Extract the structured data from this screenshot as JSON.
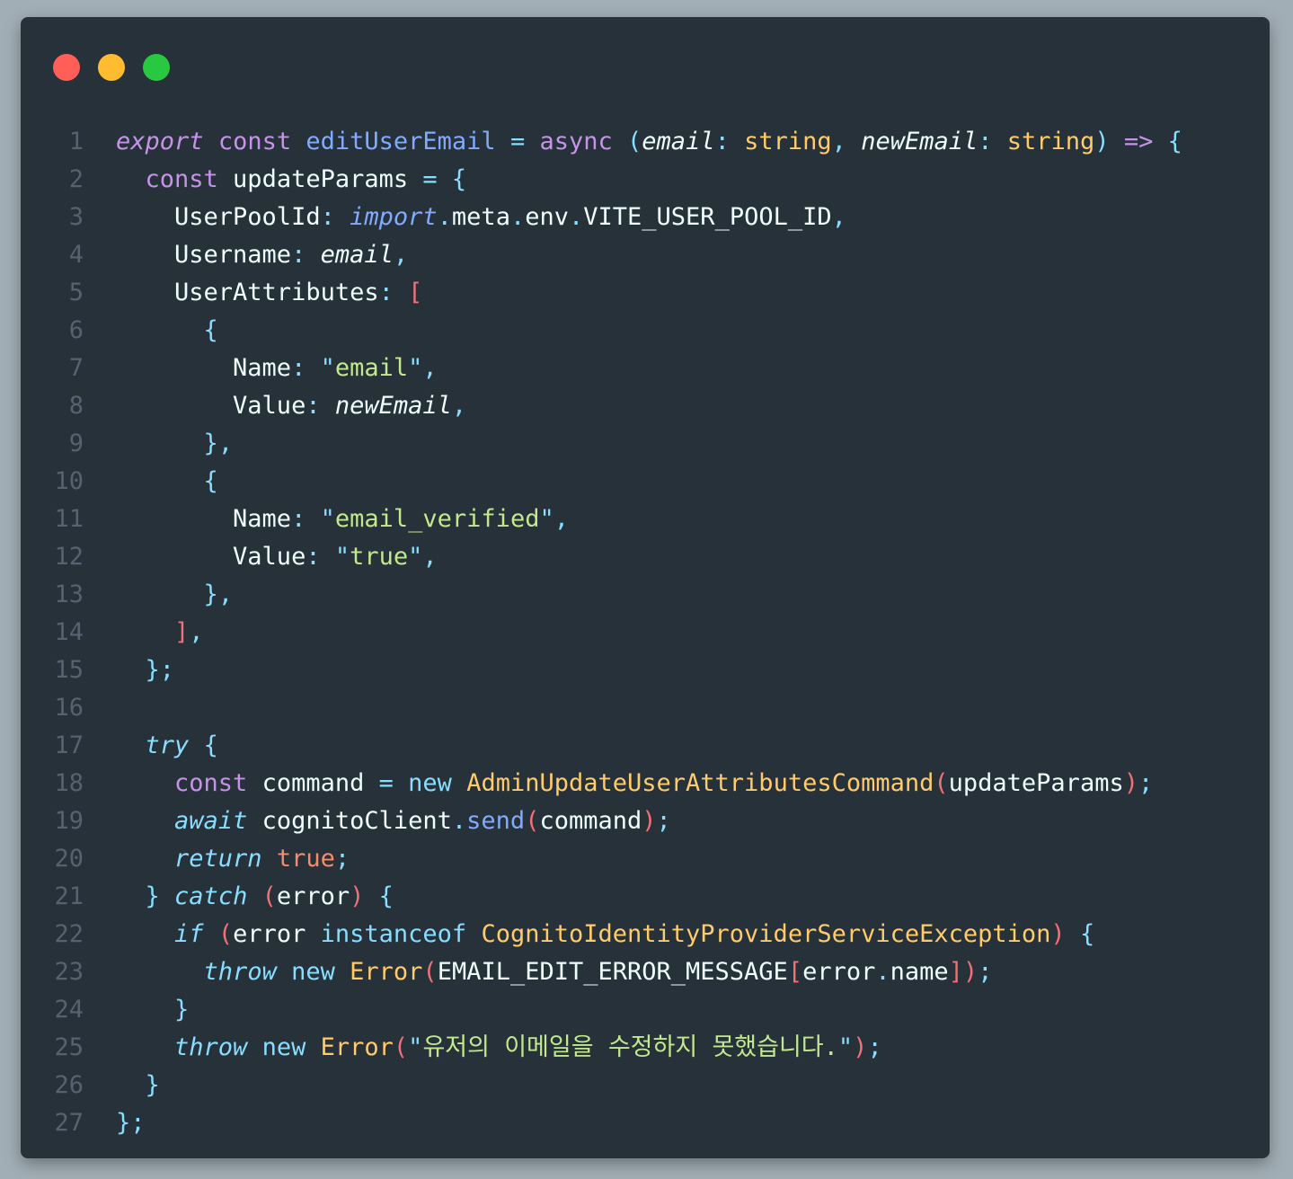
{
  "window": {
    "controls": [
      "close",
      "minimize",
      "maximize"
    ],
    "colors": {
      "background": "#263139",
      "close": "#ff5f57",
      "minimize": "#febc2e",
      "maximize": "#28c840"
    }
  },
  "code": {
    "language": "typescript",
    "lines": [
      {
        "n": "1",
        "tokens": [
          [
            "kw-i",
            "export"
          ],
          [
            "plain",
            " "
          ],
          [
            "kw",
            "const"
          ],
          [
            "plain",
            " "
          ],
          [
            "fn",
            "editUserEmail"
          ],
          [
            "plain",
            " "
          ],
          [
            "op",
            "="
          ],
          [
            "plain",
            " "
          ],
          [
            "kw",
            "async"
          ],
          [
            "plain",
            " "
          ],
          [
            "op",
            "("
          ],
          [
            "pr",
            "email"
          ],
          [
            "op",
            ":"
          ],
          [
            "plain",
            " "
          ],
          [
            "ty",
            "string"
          ],
          [
            "op",
            ","
          ],
          [
            "plain",
            " "
          ],
          [
            "pr",
            "newEmail"
          ],
          [
            "op",
            ":"
          ],
          [
            "plain",
            " "
          ],
          [
            "ty",
            "string"
          ],
          [
            "op",
            ")"
          ],
          [
            "plain",
            " "
          ],
          [
            "kw",
            "=>"
          ],
          [
            "plain",
            " "
          ],
          [
            "op",
            "{"
          ]
        ]
      },
      {
        "n": "2",
        "tokens": [
          [
            "plain",
            "  "
          ],
          [
            "kw",
            "const"
          ],
          [
            "plain",
            " updateParams "
          ],
          [
            "op",
            "="
          ],
          [
            "plain",
            " "
          ],
          [
            "op",
            "{"
          ]
        ]
      },
      {
        "n": "3",
        "tokens": [
          [
            "plain",
            "    UserPoolId"
          ],
          [
            "op",
            ":"
          ],
          [
            "plain",
            " "
          ],
          [
            "fn ital",
            "import"
          ],
          [
            "op",
            "."
          ],
          [
            "plain",
            "meta"
          ],
          [
            "op",
            "."
          ],
          [
            "plain",
            "env"
          ],
          [
            "op",
            "."
          ],
          [
            "plain",
            "VITE_USER_POOL_ID"
          ],
          [
            "op",
            ","
          ]
        ]
      },
      {
        "n": "4",
        "tokens": [
          [
            "plain",
            "    Username"
          ],
          [
            "op",
            ":"
          ],
          [
            "plain",
            " "
          ],
          [
            "pr",
            "email"
          ],
          [
            "op",
            ","
          ]
        ]
      },
      {
        "n": "5",
        "tokens": [
          [
            "plain",
            "    UserAttributes"
          ],
          [
            "op",
            ":"
          ],
          [
            "plain",
            " "
          ],
          [
            "br",
            "["
          ]
        ]
      },
      {
        "n": "6",
        "tokens": [
          [
            "plain",
            "      "
          ],
          [
            "op",
            "{"
          ]
        ]
      },
      {
        "n": "7",
        "tokens": [
          [
            "plain",
            "        Name"
          ],
          [
            "op",
            ":"
          ],
          [
            "plain",
            " "
          ],
          [
            "op",
            "\""
          ],
          [
            "str",
            "email"
          ],
          [
            "op",
            "\""
          ],
          [
            "op",
            ","
          ]
        ]
      },
      {
        "n": "8",
        "tokens": [
          [
            "plain",
            "        Value"
          ],
          [
            "op",
            ":"
          ],
          [
            "plain",
            " "
          ],
          [
            "pr",
            "newEmail"
          ],
          [
            "op",
            ","
          ]
        ]
      },
      {
        "n": "9",
        "tokens": [
          [
            "plain",
            "      "
          ],
          [
            "op",
            "}"
          ],
          [
            "op",
            ","
          ]
        ]
      },
      {
        "n": "10",
        "tokens": [
          [
            "plain",
            "      "
          ],
          [
            "op",
            "{"
          ]
        ]
      },
      {
        "n": "11",
        "tokens": [
          [
            "plain",
            "        Name"
          ],
          [
            "op",
            ":"
          ],
          [
            "plain",
            " "
          ],
          [
            "op",
            "\""
          ],
          [
            "str",
            "email_verified"
          ],
          [
            "op",
            "\""
          ],
          [
            "op",
            ","
          ]
        ]
      },
      {
        "n": "12",
        "tokens": [
          [
            "plain",
            "        Value"
          ],
          [
            "op",
            ":"
          ],
          [
            "plain",
            " "
          ],
          [
            "op",
            "\""
          ],
          [
            "str",
            "true"
          ],
          [
            "op",
            "\""
          ],
          [
            "op",
            ","
          ]
        ]
      },
      {
        "n": "13",
        "tokens": [
          [
            "plain",
            "      "
          ],
          [
            "op",
            "}"
          ],
          [
            "op",
            ","
          ]
        ]
      },
      {
        "n": "14",
        "tokens": [
          [
            "plain",
            "    "
          ],
          [
            "br",
            "]"
          ],
          [
            "op",
            ","
          ]
        ]
      },
      {
        "n": "15",
        "tokens": [
          [
            "plain",
            "  "
          ],
          [
            "op",
            "};"
          ]
        ]
      },
      {
        "n": "16",
        "tokens": []
      },
      {
        "n": "17",
        "tokens": [
          [
            "plain",
            "  "
          ],
          [
            "blue ital",
            "try"
          ],
          [
            "plain",
            " "
          ],
          [
            "op",
            "{"
          ]
        ]
      },
      {
        "n": "18",
        "tokens": [
          [
            "plain",
            "    "
          ],
          [
            "kw",
            "const"
          ],
          [
            "plain",
            " command "
          ],
          [
            "op",
            "="
          ],
          [
            "plain",
            " "
          ],
          [
            "blue",
            "new"
          ],
          [
            "plain",
            " "
          ],
          [
            "cls",
            "AdminUpdateUserAttributesCommand"
          ],
          [
            "br",
            "("
          ],
          [
            "plain",
            "updateParams"
          ],
          [
            "br",
            ")"
          ],
          [
            "op",
            ";"
          ]
        ]
      },
      {
        "n": "19",
        "tokens": [
          [
            "plain",
            "    "
          ],
          [
            "blue ital",
            "await"
          ],
          [
            "plain",
            " cognitoClient"
          ],
          [
            "op",
            "."
          ],
          [
            "fn",
            "send"
          ],
          [
            "br",
            "("
          ],
          [
            "plain",
            "command"
          ],
          [
            "br",
            ")"
          ],
          [
            "op",
            ";"
          ]
        ]
      },
      {
        "n": "20",
        "tokens": [
          [
            "plain",
            "    "
          ],
          [
            "blue ital",
            "return"
          ],
          [
            "plain",
            " "
          ],
          [
            "br2",
            "true"
          ],
          [
            "op",
            ";"
          ]
        ]
      },
      {
        "n": "21",
        "tokens": [
          [
            "plain",
            "  "
          ],
          [
            "op",
            "}"
          ],
          [
            "plain",
            " "
          ],
          [
            "blue ital",
            "catch"
          ],
          [
            "plain",
            " "
          ],
          [
            "br",
            "("
          ],
          [
            "plain",
            "error"
          ],
          [
            "br",
            ")"
          ],
          [
            "plain",
            " "
          ],
          [
            "op",
            "{"
          ]
        ]
      },
      {
        "n": "22",
        "tokens": [
          [
            "plain",
            "    "
          ],
          [
            "blue ital",
            "if"
          ],
          [
            "plain",
            " "
          ],
          [
            "br",
            "("
          ],
          [
            "plain",
            "error "
          ],
          [
            "blue",
            "instanceof"
          ],
          [
            "plain",
            " "
          ],
          [
            "cls",
            "CognitoIdentityProviderServiceException"
          ],
          [
            "br",
            ")"
          ],
          [
            "plain",
            " "
          ],
          [
            "op",
            "{"
          ]
        ]
      },
      {
        "n": "23",
        "tokens": [
          [
            "plain",
            "      "
          ],
          [
            "blue ital",
            "throw"
          ],
          [
            "plain",
            " "
          ],
          [
            "blue",
            "new"
          ],
          [
            "plain",
            " "
          ],
          [
            "cls",
            "Error"
          ],
          [
            "br",
            "("
          ],
          [
            "plain",
            "EMAIL_EDIT_ERROR_MESSAGE"
          ],
          [
            "br",
            "["
          ],
          [
            "plain",
            "error"
          ],
          [
            "op",
            "."
          ],
          [
            "plain",
            "name"
          ],
          [
            "br",
            "])"
          ],
          [
            "op",
            ";"
          ]
        ]
      },
      {
        "n": "24",
        "tokens": [
          [
            "plain",
            "    "
          ],
          [
            "op",
            "}"
          ]
        ]
      },
      {
        "n": "25",
        "tokens": [
          [
            "plain",
            "    "
          ],
          [
            "blue ital",
            "throw"
          ],
          [
            "plain",
            " "
          ],
          [
            "blue",
            "new"
          ],
          [
            "plain",
            " "
          ],
          [
            "cls",
            "Error"
          ],
          [
            "br",
            "("
          ],
          [
            "op",
            "\""
          ],
          [
            "str",
            "유저의 이메일을 수정하지 못했습니다."
          ],
          [
            "op",
            "\""
          ],
          [
            "br",
            ")"
          ],
          [
            "op",
            ";"
          ]
        ]
      },
      {
        "n": "26",
        "tokens": [
          [
            "plain",
            "  "
          ],
          [
            "op",
            "}"
          ]
        ]
      },
      {
        "n": "27",
        "tokens": [
          [
            "op",
            "};"
          ]
        ]
      }
    ]
  }
}
